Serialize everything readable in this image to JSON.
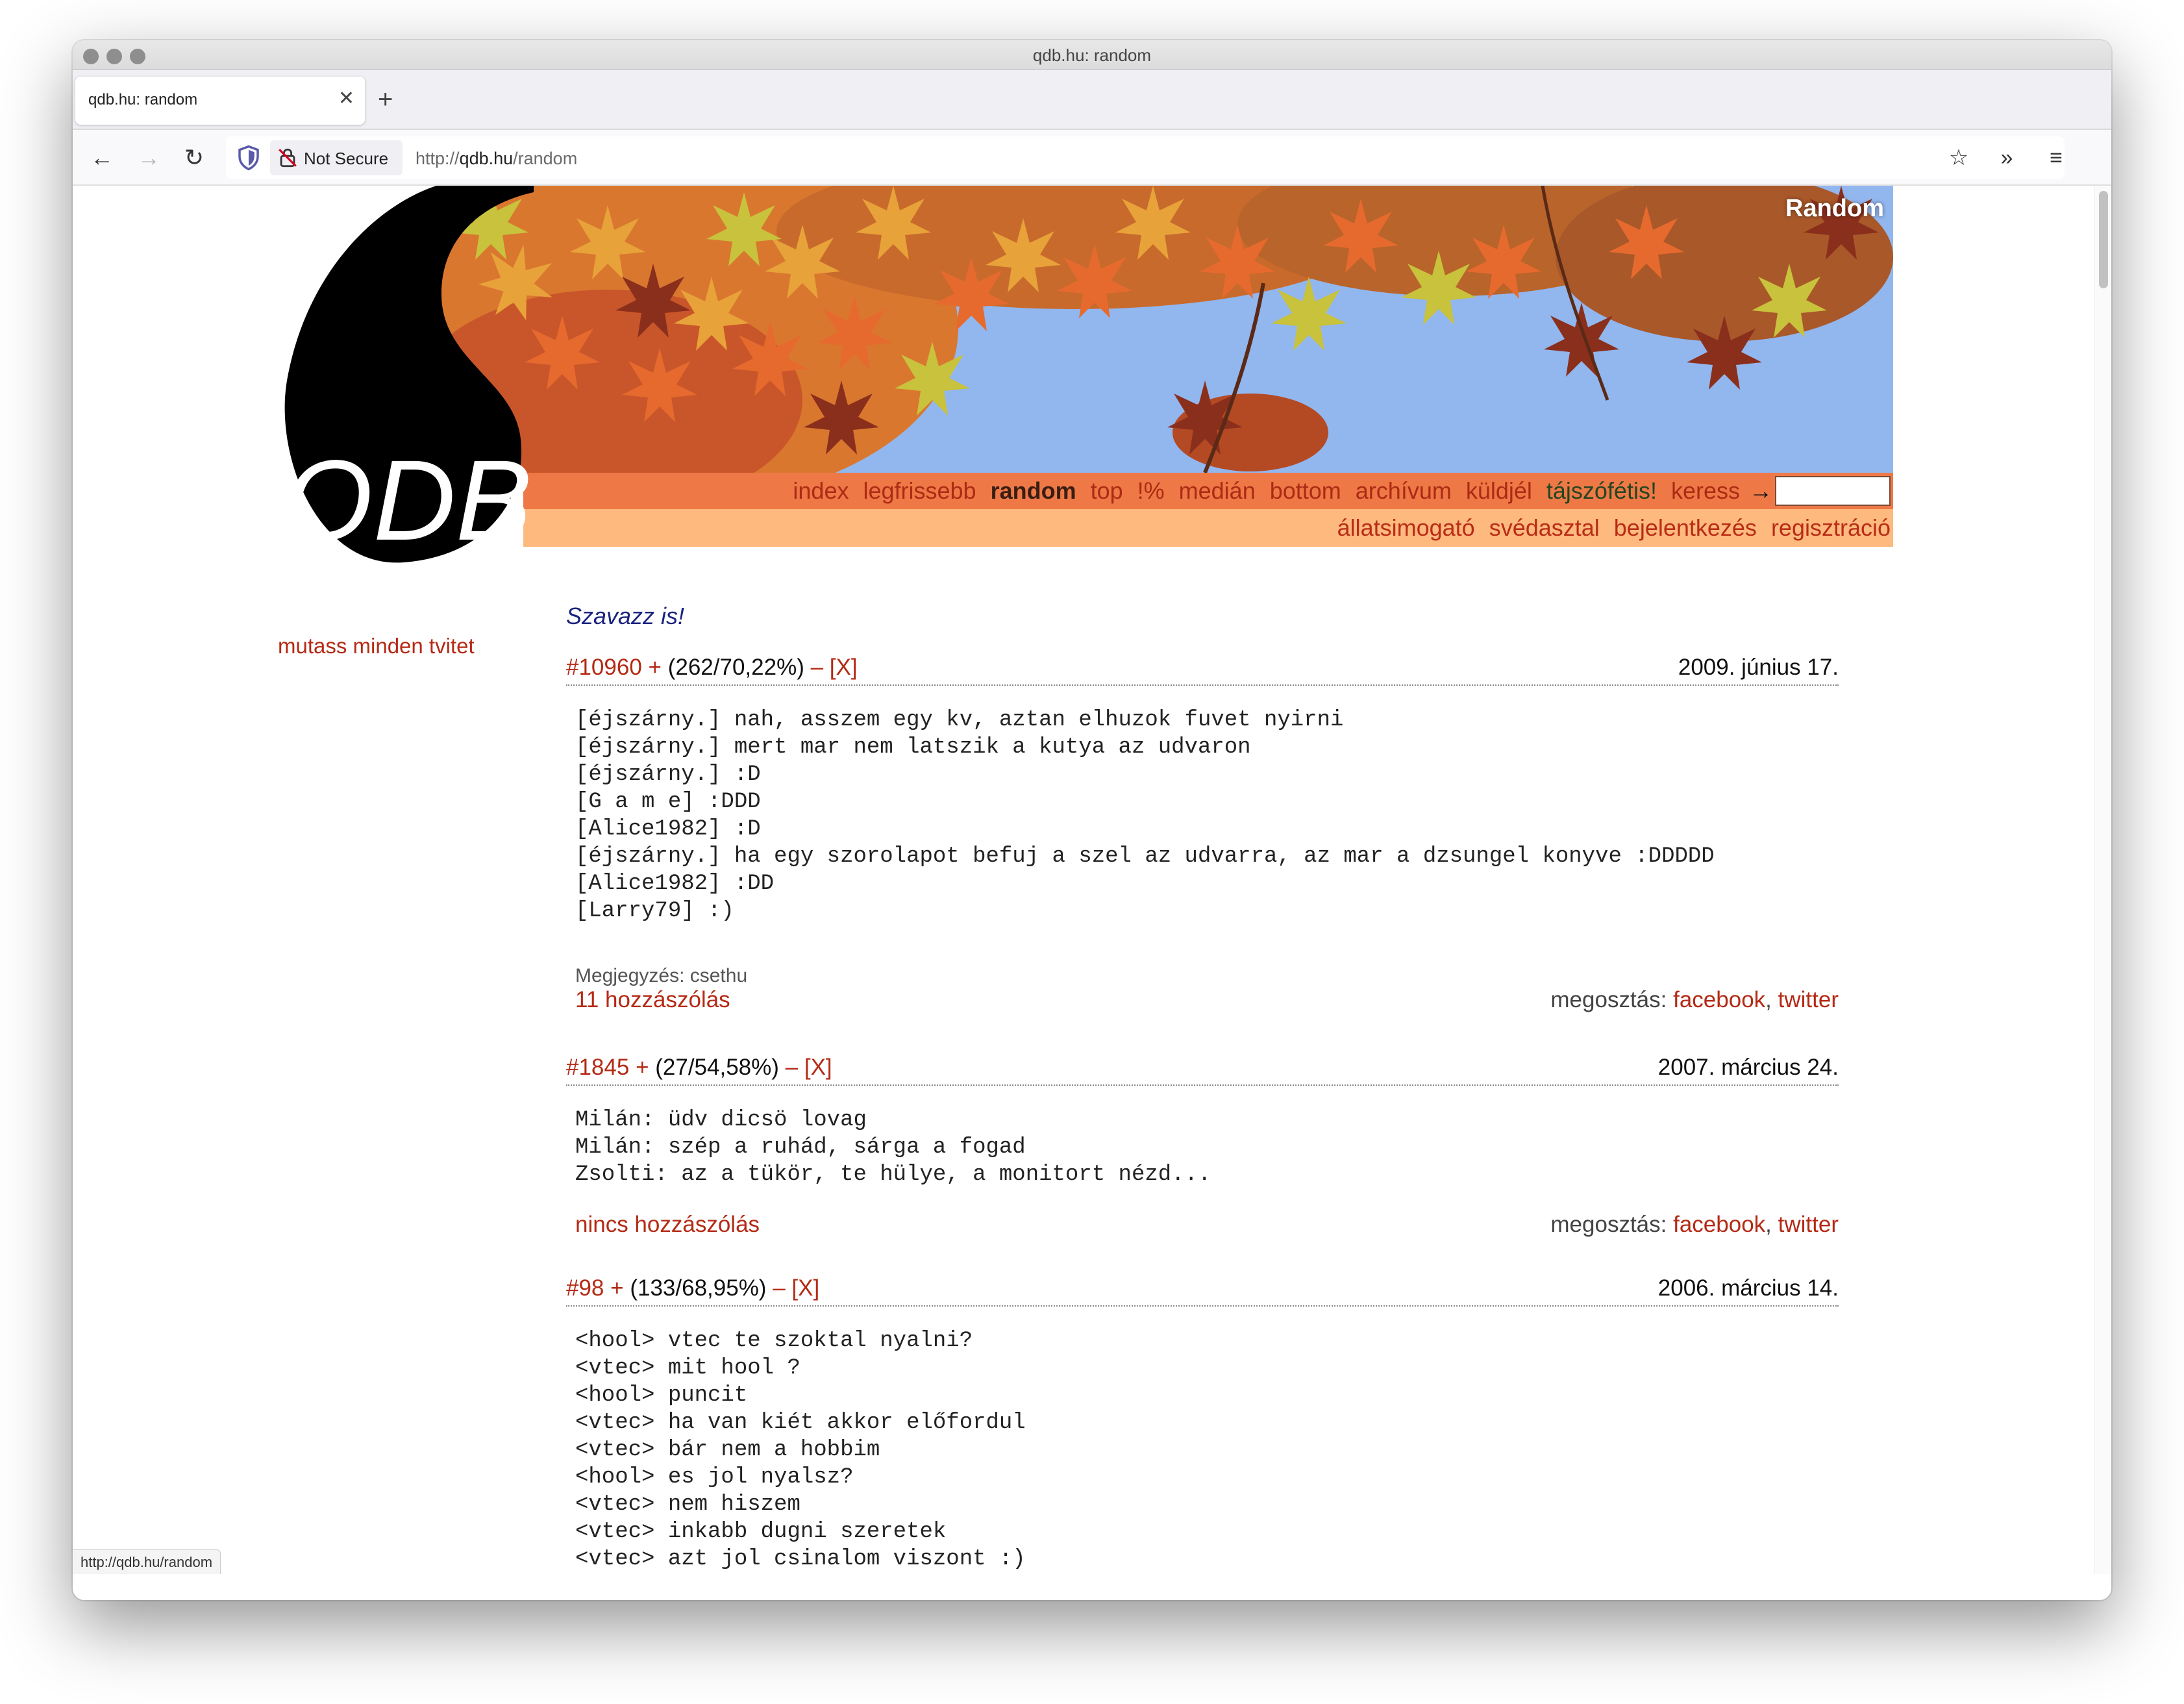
{
  "browser": {
    "window_title": "qdb.hu: random",
    "tab_title": "qdb.hu: random",
    "security_label": "Not Secure",
    "url_prefix": "http://",
    "url_host": "qdb.hu",
    "url_path": "/random",
    "status_url": "http://qdb.hu/random"
  },
  "header": {
    "logo_text": "QDB",
    "banner_label": "Random",
    "nav_main": [
      "index",
      "legfrissebb",
      "random",
      "top",
      "!%",
      "medián",
      "bottom",
      "archívum",
      "küldjél",
      "tájszófétis!",
      "keress"
    ],
    "nav_current": "random",
    "nav_arrow": "→",
    "search_value": "",
    "nav_secondary": [
      "állatsimogató",
      "svédasztal",
      "bejelentkezés",
      "regisztráció"
    ]
  },
  "sidebar": {
    "show_all_tweets": "mutass minden tvitet"
  },
  "vote_prompt": "Szavazz is!",
  "quotes": [
    {
      "id": "#10960",
      "plus": "+",
      "score": "(262/70,22%)",
      "minus": "–",
      "flag": "[X]",
      "date": "2009. június 17.",
      "text": "[éjszárny.] nah, asszem egy kv, aztan elhuzok fuvet nyirni\n[éjszárny.] mert mar nem latszik a kutya az udvaron\n[éjszárny.] :D\n[G a m e] :DDD\n[Alice1982] :D\n[éjszárny.] ha egy szorolapot befuj a szel az udvarra, az mar a dzsungel konyve :DDDDD\n[Alice1982] :DD\n[Larry79] :)",
      "note": "Megjegyzés: csethu",
      "comments": "11 hozzászólás",
      "share_label": "megosztás:",
      "share_facebook": "facebook",
      "share_sep": ",",
      "share_twitter": "twitter"
    },
    {
      "id": "#1845",
      "plus": "+",
      "score": "(27/54,58%)",
      "minus": "–",
      "flag": "[X]",
      "date": "2007. március 24.",
      "text": "Milán: üdv dicsö lovag\nMilán: szép a ruhád, sárga a fogad\nZsolti: az a tükör, te hülye, a monitort nézd...",
      "comments": "nincs hozzászólás",
      "share_label": "megosztás:",
      "share_facebook": "facebook",
      "share_sep": ",",
      "share_twitter": "twitter"
    },
    {
      "id": "#98",
      "plus": "+",
      "score": "(133/68,95%)",
      "minus": "–",
      "flag": "[X]",
      "date": "2006. március 14.",
      "text": "<hool> vtec te szoktal nyalni?\n<vtec> mit hool ?\n<hool> puncit\n<vtec> ha van kiét akkor előfordul\n<vtec> bár nem a hobbim\n<hool> es jol nyalsz?\n<vtec> nem hiszem\n<vtec> inkabb dugni szeretek\n<vtec> azt jol csinalom viszont :)\n<hool> hat ezaz\n<hool> kene vmi nyalas-howto"
    }
  ],
  "colors": {
    "link_red": "#b42a15",
    "nav_band": "#ee7947",
    "nav_band_light": "#fdb97e",
    "vote_blue": "#1a237e"
  }
}
